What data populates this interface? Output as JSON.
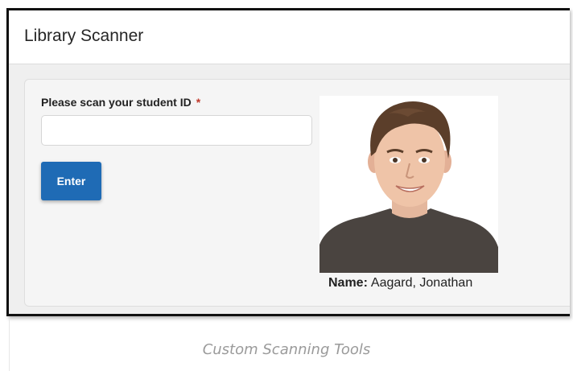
{
  "window": {
    "title": "Library Scanner"
  },
  "form": {
    "label": "Please scan your student ID",
    "required_marker": "*",
    "input_value": "",
    "enter_label": "Enter"
  },
  "student": {
    "name_label": "Name:",
    "name": "Aagard, Jonathan"
  },
  "caption": "Custom Scanning Tools",
  "colors": {
    "primary_button": "#1f6bb5",
    "required": "#c0392b"
  }
}
